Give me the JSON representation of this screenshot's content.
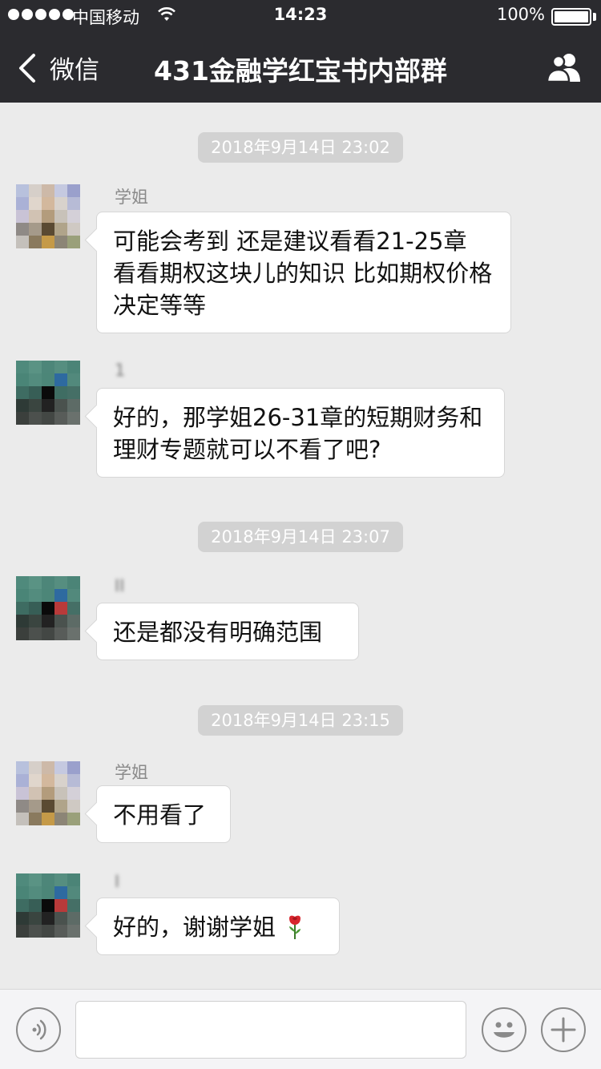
{
  "status_bar": {
    "carrier": "中国移动",
    "time": "14:23",
    "battery": "100%"
  },
  "nav": {
    "back_label": "微信",
    "title": "431金融学红宝书内部群"
  },
  "messages": [
    {
      "timestamp": "2018年9月14日 23:02"
    },
    {
      "sender": "学姐",
      "text": "可能会考到 还是建议看看21-25章 看看期权这块儿的知识 比如期权价格决定等等"
    },
    {
      "sender": "1 ",
      "text": "好的，那学姐26-31章的短期财务和理财专题就可以不看了吧?"
    },
    {
      "timestamp": "2018年9月14日 23:07"
    },
    {
      "sender": "II ",
      "text": "还是都没有明确范围"
    },
    {
      "timestamp": "2018年9月14日 23:15"
    },
    {
      "sender": "学姐",
      "text": "不用看了"
    },
    {
      "sender": "I ",
      "text": "好的，谢谢学姐"
    }
  ],
  "icons": {
    "back": "chevron-left-icon",
    "members": "group-members-icon",
    "voice": "voice-icon",
    "emoji": "emoji-icon",
    "plus": "plus-icon",
    "rose": "rose-emoji"
  },
  "colors": {
    "header_bg": "#2b2b2f",
    "chat_bg": "#ebebeb",
    "timestamp_bg": "#d2d2d2",
    "bubble_bg": "#ffffff"
  }
}
